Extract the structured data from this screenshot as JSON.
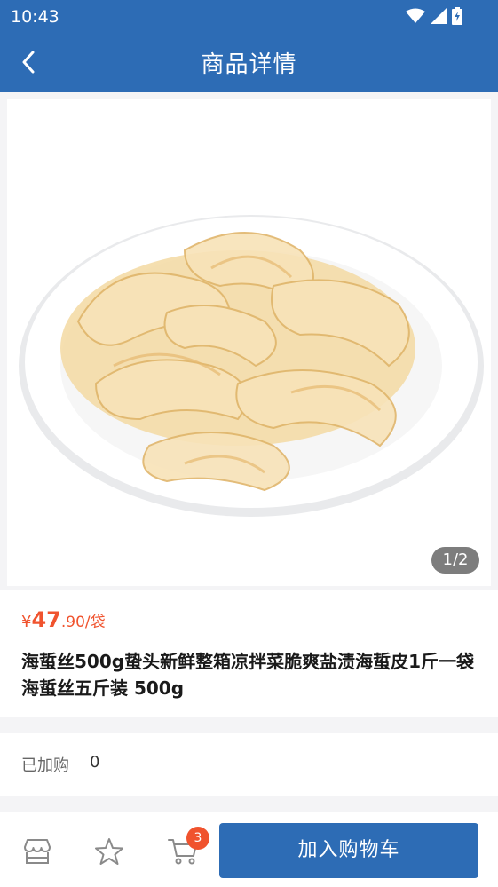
{
  "status_bar": {
    "time": "10:43"
  },
  "header": {
    "title": "商品详情",
    "back_icon": "chevron-left-icon"
  },
  "gallery": {
    "pager": "1/2",
    "image_subject": "jellyfish-salad-plate"
  },
  "product": {
    "price_currency": "¥",
    "price_int": "47",
    "price_dec": ".90",
    "price_unit": "/袋",
    "name": "海蜇丝500g蛰头新鲜整箱凉拌菜脆爽盐渍海蜇皮1斤一袋海蜇丝五斤装 500g"
  },
  "added": {
    "label": "已加购",
    "value": "0"
  },
  "bottom_bar": {
    "store_icon": "store-icon",
    "favorite_icon": "star-icon",
    "cart_icon": "cart-icon",
    "cart_badge": "3",
    "add_button": "加入购物车"
  },
  "colors": {
    "primary": "#2d6cb5",
    "accent": "#f0532e"
  }
}
